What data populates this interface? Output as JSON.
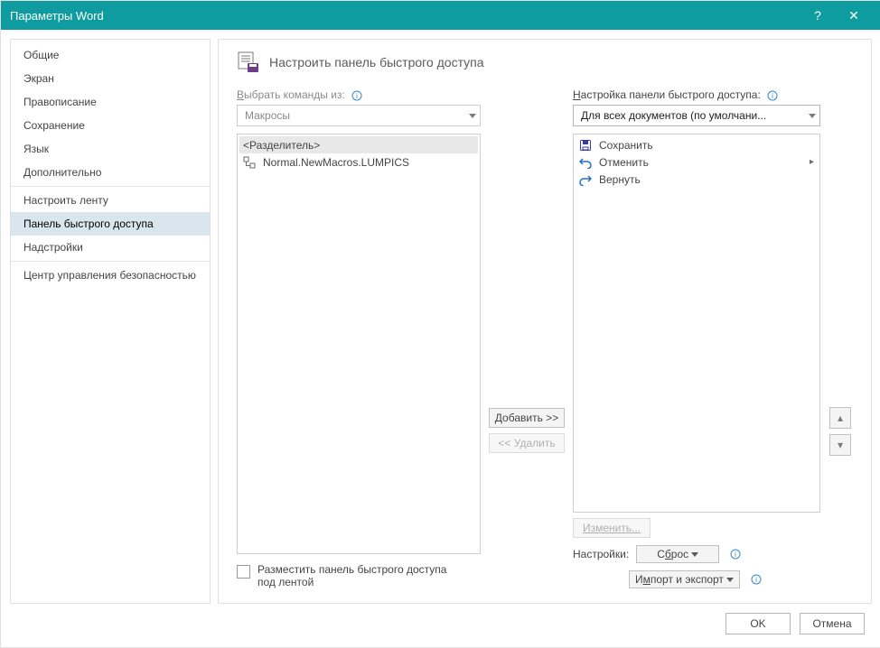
{
  "title": "Параметры Word",
  "help": "?",
  "close": "✕",
  "sidebar": {
    "items": [
      "Общие",
      "Экран",
      "Правописание",
      "Сохранение",
      "Язык",
      "Дополнительно",
      "Настроить ленту",
      "Панель быстрого доступа",
      "Надстройки",
      "Центр управления безопасностью"
    ],
    "selected_index": 7
  },
  "heading": "Настроить панель быстрого доступа",
  "left": {
    "label_prefix": "В",
    "label_rest": "ыбрать команды из:",
    "combo": "Макросы",
    "items": [
      {
        "text": "<Разделитель>",
        "selected": true,
        "icon": "none"
      },
      {
        "text": "Normal.NewMacros.LUMPICS",
        "selected": false,
        "icon": "macro"
      }
    ]
  },
  "mid": {
    "add": "Добавить >>",
    "remove": "<< Удалить"
  },
  "right": {
    "label_prefix": "Н",
    "label_rest": "астройка панели быстрого доступа:",
    "combo": "Для всех документов (по умолчани...",
    "items": [
      {
        "icon": "save",
        "text": "Сохранить"
      },
      {
        "icon": "undo",
        "text": "Отменить",
        "expand": true
      },
      {
        "icon": "redo",
        "text": "Вернуть"
      }
    ],
    "modify": "Изменить...",
    "settings_label": "Настройки:",
    "reset": "Сброс",
    "import_export": "Импорт и экспорт"
  },
  "checkbox": "Разместить панель быстрого доступа под лентой",
  "footer": {
    "ok": "OK",
    "cancel": "Отмена"
  }
}
